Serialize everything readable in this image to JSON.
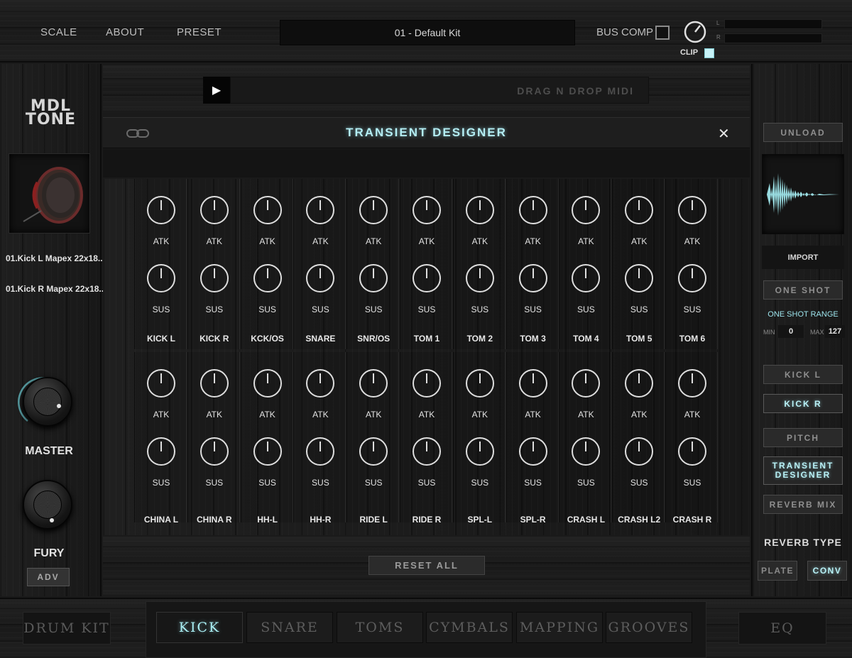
{
  "topbar": {
    "menu": [
      "SCALE",
      "ABOUT",
      "PRESET"
    ],
    "preset_name": "01 - Default Kit",
    "bus_comp_label": "BUS COMP",
    "clip_label": "CLIP",
    "meter_labels": [
      "L",
      "R"
    ]
  },
  "left": {
    "logo_line1": "MDL",
    "logo_line2": "TONE",
    "samples": [
      "01.Kick L Mapex 22x18...",
      "01.Kick R Mapex 22x18..."
    ],
    "master_label": "MASTER",
    "fury_label": "FURY",
    "adv_label": "ADV"
  },
  "midi": {
    "drop_text": "DRAG N DROP MIDI"
  },
  "transient": {
    "title": "TRANSIENT DESIGNER",
    "atk_label": "ATK",
    "sus_label": "SUS",
    "row1": [
      "KICK L",
      "KICK R",
      "KCK/OS",
      "SNARE",
      "SNR/OS",
      "TOM 1",
      "TOM 2",
      "TOM 3",
      "TOM 4",
      "TOM 5",
      "TOM 6"
    ],
    "row2": [
      "CHINA L",
      "CHINA R",
      "HH-L",
      "HH-R",
      "RIDE L",
      "RIDE R",
      "SPL-L",
      "SPL-R",
      "CRASH L",
      "CRASH L2",
      "CRASH R"
    ],
    "reset_label": "RESET ALL"
  },
  "right": {
    "unload": "UNLOAD",
    "import": "IMPORT",
    "one_shot": "ONE SHOT",
    "one_shot_range": "ONE SHOT RANGE",
    "min_label": "MIN",
    "min_value": "0",
    "max_label": "MAX",
    "max_value": "127",
    "kick_l": "KICK L",
    "kick_r": "KICK R",
    "pitch": "PITCH",
    "transient_line1": "TRANSIENT",
    "transient_line2": "DESIGNER",
    "reverb_mix": "REVERB MIX",
    "reverb_type": "REVERB TYPE",
    "plate": "PLATE",
    "conv": "CONV"
  },
  "bottom": {
    "drum_kit": "DRUM KIT",
    "tabs": [
      "KICK",
      "SNARE",
      "TOMS",
      "CYMBALS",
      "MAPPING",
      "GROOVES"
    ],
    "active_tab": "KICK",
    "eq": "EQ"
  },
  "colors": {
    "accent": "#b4eef4",
    "clip_led": "#c7f3f8"
  }
}
